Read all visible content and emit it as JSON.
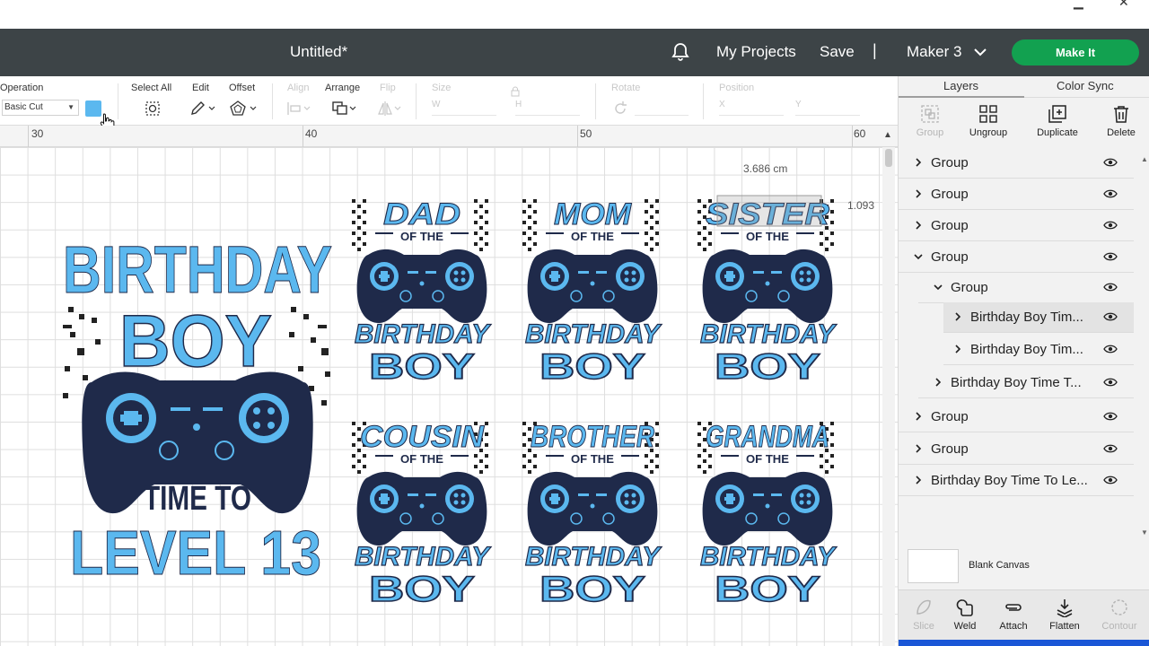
{
  "header": {
    "title": "Untitled*",
    "my_projects": "My Projects",
    "save": "Save",
    "separator": "|",
    "machine": "Maker 3",
    "make_it": "Make It"
  },
  "toolbar": {
    "operation_label": "Operation",
    "operation_value": "Basic Cut",
    "swatch_color": "#5bb8ef",
    "select_all": "Select All",
    "edit": "Edit",
    "offset": "Offset",
    "align": "Align",
    "arrange": "Arrange",
    "flip": "Flip",
    "size": "Size",
    "size_w": "W",
    "size_h": "H",
    "rotate": "Rotate",
    "position": "Position",
    "pos_x": "X",
    "pos_y": "Y"
  },
  "ruler": {
    "n30": "30",
    "n40": "40",
    "n50": "50",
    "n60": "60"
  },
  "canvas": {
    "dim_width": "3.686 cm",
    "dim_height": "1.093",
    "big_design": {
      "line1": "BIRTHDAY",
      "line2": "BOY",
      "line3": "TIME TO",
      "line4": "LEVEL 13"
    },
    "small_designs": [
      {
        "name": "DAD",
        "of": "OF THE",
        "b1": "BIRTHDAY",
        "b2": "BOY"
      },
      {
        "name": "MOM",
        "of": "OF THE",
        "b1": "BIRTHDAY",
        "b2": "BOY"
      },
      {
        "name": "SISTER",
        "of": "OF THE",
        "b1": "BIRTHDAY",
        "b2": "BOY"
      },
      {
        "name": "COUSIN",
        "of": "OF THE",
        "b1": "BIRTHDAY",
        "b2": "BOY"
      },
      {
        "name": "BROTHER",
        "of": "OF THE",
        "b1": "BIRTHDAY",
        "b2": "BOY"
      },
      {
        "name": "GRANDMA",
        "of": "OF THE",
        "b1": "BIRTHDAY",
        "b2": "BOY"
      }
    ]
  },
  "panel": {
    "tabs": [
      "Layers",
      "Color Sync"
    ],
    "tools": [
      "Group",
      "Ungroup",
      "Duplicate",
      "Delete"
    ],
    "layers": [
      "Group",
      "Group",
      "Group",
      "Group",
      "Group",
      "Birthday Boy Tim...",
      "Birthday Boy Tim...",
      "Birthday Boy Time T...",
      "Group",
      "Group",
      "Birthday Boy Time To Le..."
    ],
    "blank_canvas": "Blank Canvas",
    "bottom_tools": [
      "Slice",
      "Weld",
      "Attach",
      "Flatten",
      "Contour"
    ]
  },
  "colors": {
    "accent_blue": "#5bb8ef",
    "controller_navy": "#1f2a4a",
    "header_bg": "#3d4447",
    "make_it_green": "#12a150"
  }
}
